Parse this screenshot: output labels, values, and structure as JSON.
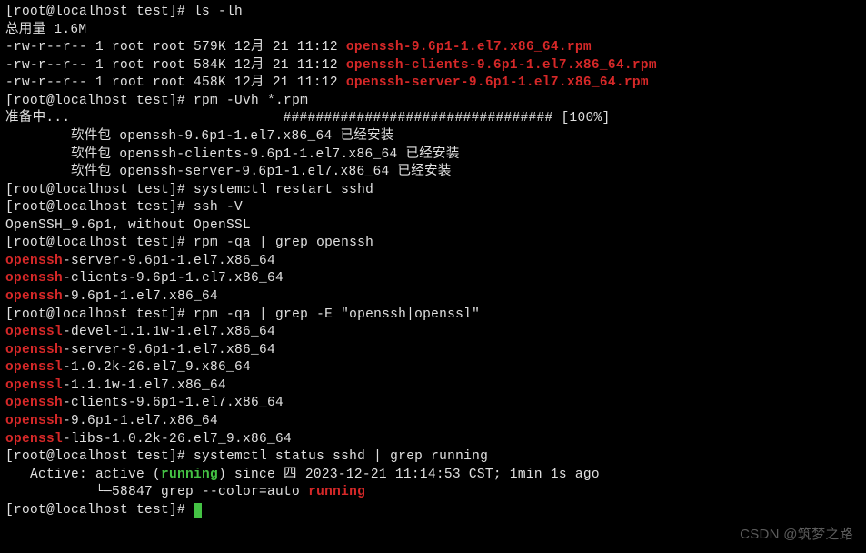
{
  "prompt": "[root@localhost test]# ",
  "cmd": {
    "ls": "ls -lh",
    "rpm_uvh": "rpm -Uvh *.rpm",
    "restart": "systemctl restart sshd",
    "sshv": "ssh -V",
    "rpm_qa1": "rpm -qa | grep openssh",
    "rpm_qa2": "rpm -qa | grep -E \"openssh|openssl\"",
    "status": "systemctl status sshd | grep running"
  },
  "ls_total": "总用量 1.6M",
  "ls_files": [
    {
      "perm": "-rw-r--r-- 1 root root 579K 12月 21 11:12 ",
      "name": "openssh-9.6p1-1.el7.x86_64.rpm"
    },
    {
      "perm": "-rw-r--r-- 1 root root 584K 12月 21 11:12 ",
      "name": "openssh-clients-9.6p1-1.el7.x86_64.rpm"
    },
    {
      "perm": "-rw-r--r-- 1 root root 458K 12月 21 11:12 ",
      "name": "openssh-server-9.6p1-1.el7.x86_64.rpm"
    }
  ],
  "preparing": "准备中...                          ################################# [100%]",
  "installed": [
    "        软件包 openssh-9.6p1-1.el7.x86_64 已经安装",
    "        软件包 openssh-clients-9.6p1-1.el7.x86_64 已经安装",
    "        软件包 openssh-server-9.6p1-1.el7.x86_64 已经安装"
  ],
  "ssh_version": "OpenSSH_9.6p1, without OpenSSL",
  "grep1": [
    {
      "hl": "openssh",
      "rest": "-server-9.6p1-1.el7.x86_64"
    },
    {
      "hl": "openssh",
      "rest": "-clients-9.6p1-1.el7.x86_64"
    },
    {
      "hl": "openssh",
      "rest": "-9.6p1-1.el7.x86_64"
    }
  ],
  "grep2": [
    {
      "hl": "openssl",
      "rest": "-devel-1.1.1w-1.el7.x86_64"
    },
    {
      "hl": "openssh",
      "rest": "-server-9.6p1-1.el7.x86_64"
    },
    {
      "hl": "openssl",
      "rest": "-1.0.2k-26.el7_9.x86_64"
    },
    {
      "hl": "openssl",
      "rest": "-1.1.1w-1.el7.x86_64"
    },
    {
      "hl": "openssh",
      "rest": "-clients-9.6p1-1.el7.x86_64"
    },
    {
      "hl": "openssh",
      "rest": "-9.6p1-1.el7.x86_64"
    },
    {
      "hl": "openssl",
      "rest": "-libs-1.0.2k-26.el7_9.x86_64"
    }
  ],
  "status_out": {
    "line1_pre": "   Active: active (",
    "line1_hl": "running",
    "line1_post": ") since 四 2023-12-21 11:14:53 CST; 1min 1s ago",
    "line2_pre": "           └─58847 grep --color=auto ",
    "line2_hl": "running"
  },
  "watermark": "CSDN @筑梦之路"
}
